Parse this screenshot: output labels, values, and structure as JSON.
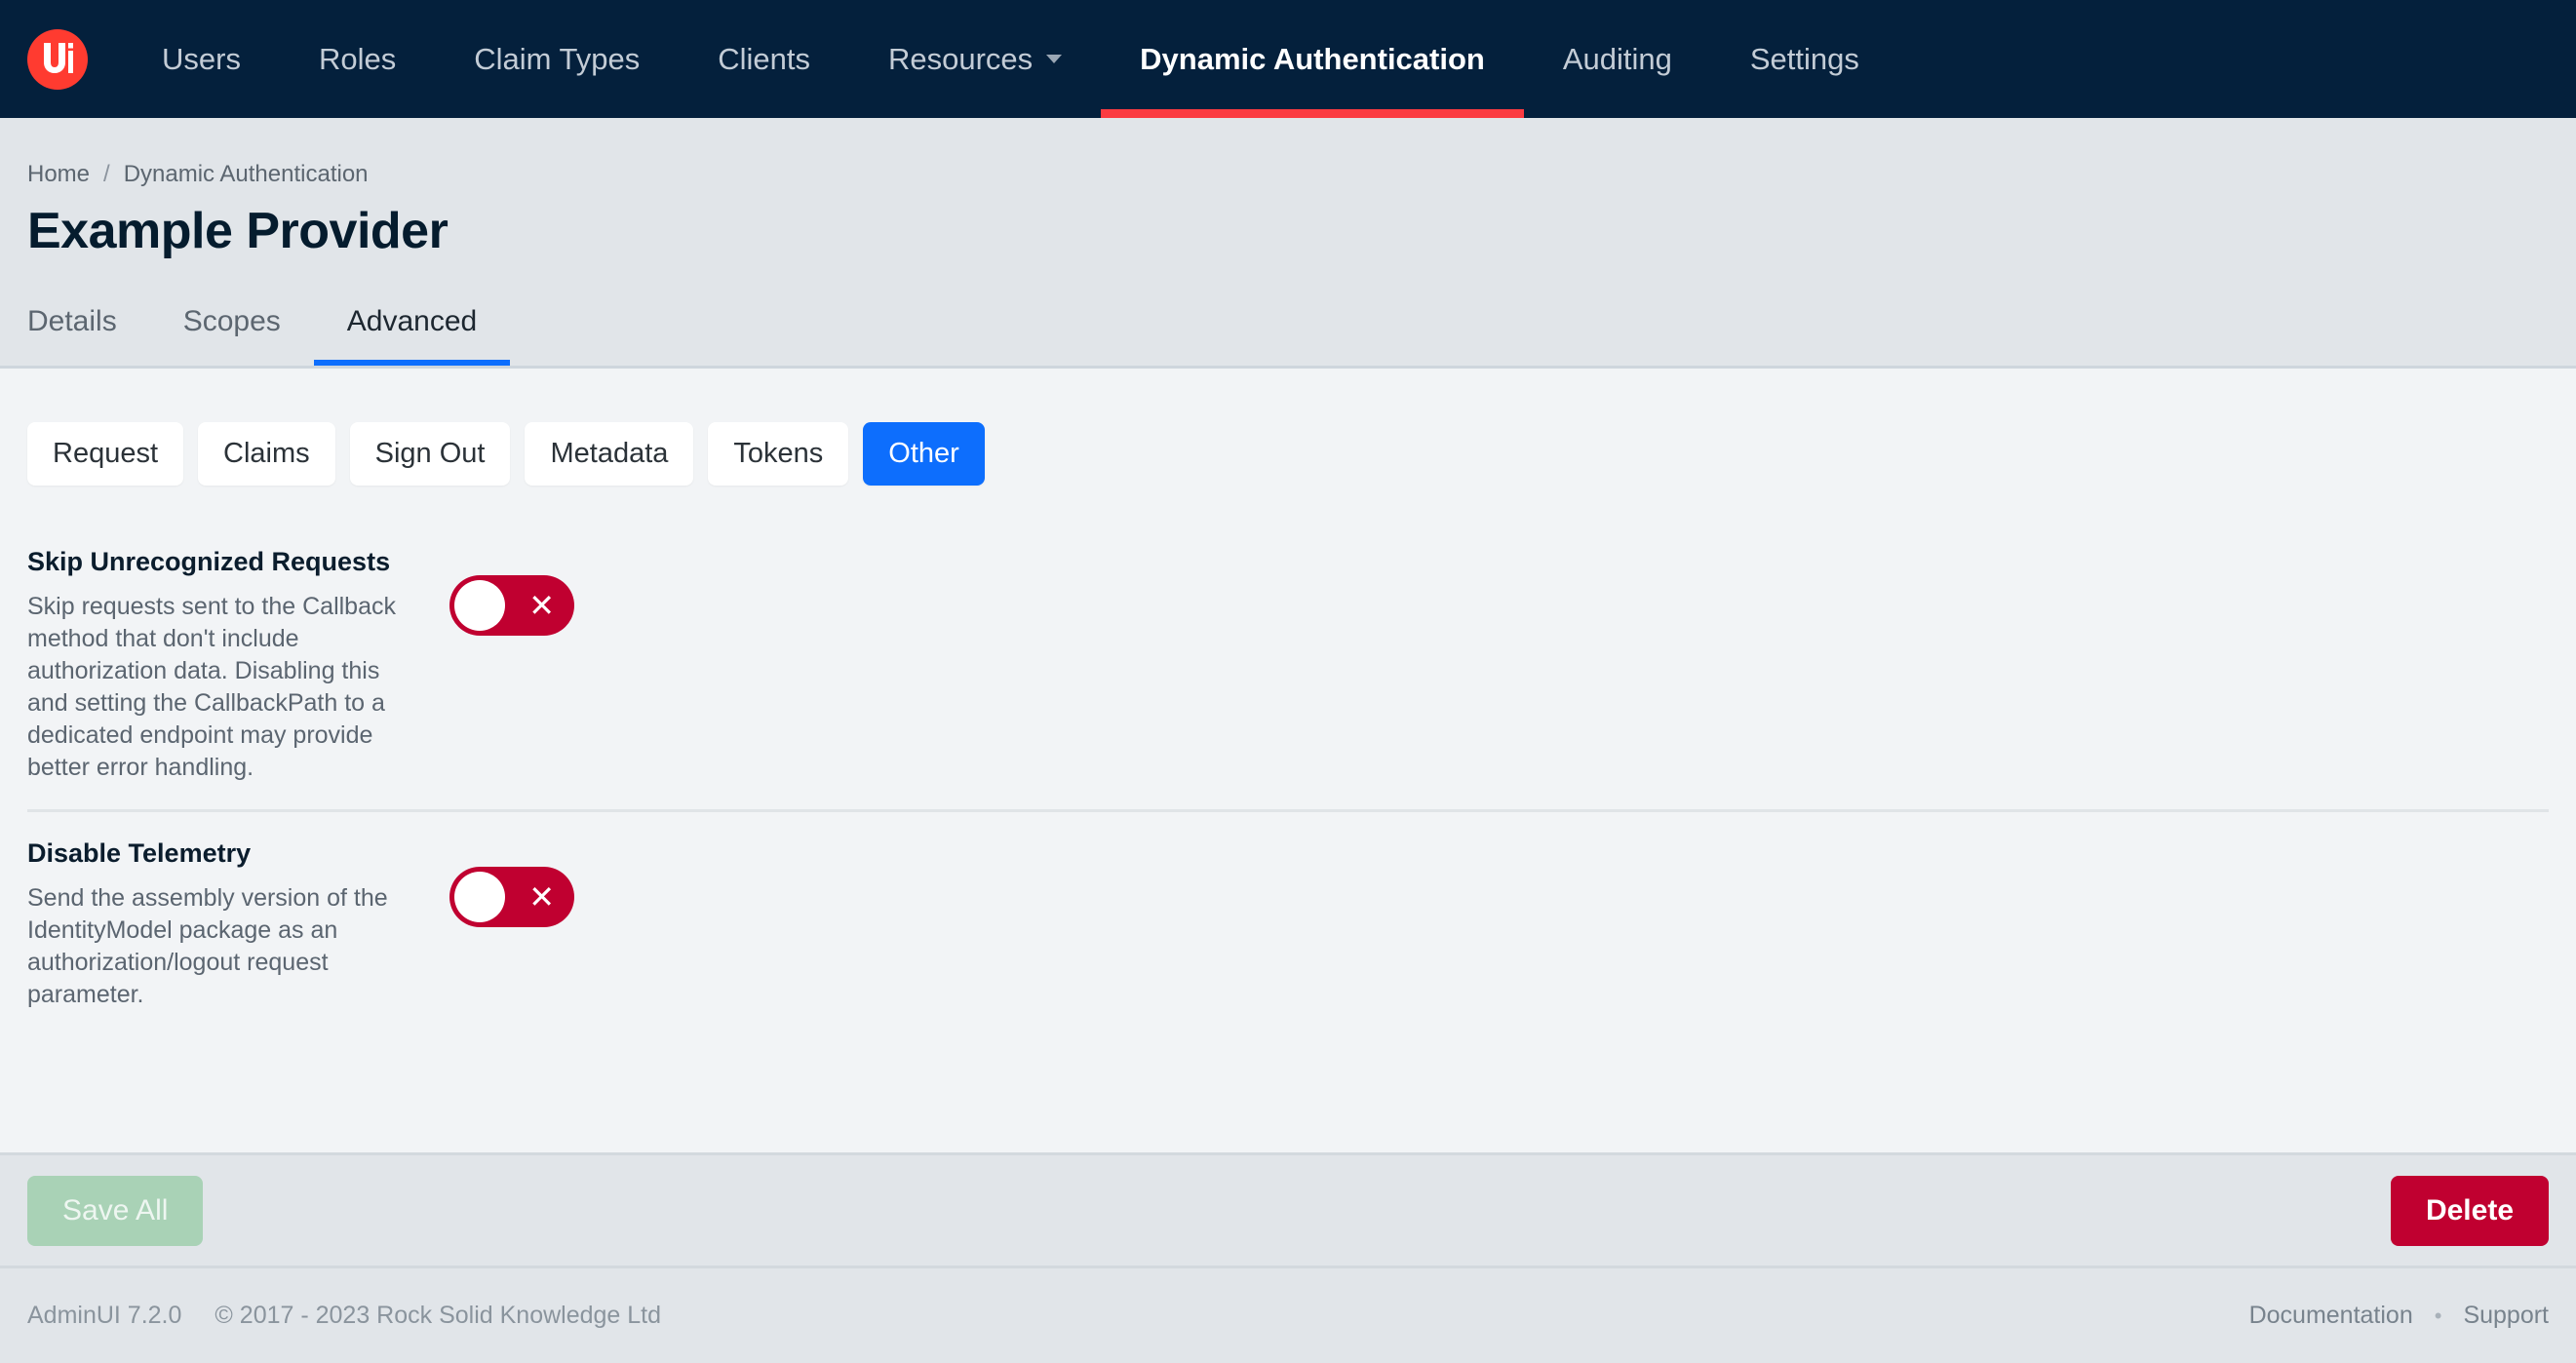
{
  "navbar": {
    "logo_text": "U",
    "logo_icon": "adminui-logo-icon",
    "brand_color": "#ff3b30",
    "background_color": "#04203c",
    "active_indicator_color": "#fb3b41",
    "items": [
      {
        "label": "Users",
        "active": false,
        "has_caret": false
      },
      {
        "label": "Roles",
        "active": false,
        "has_caret": false
      },
      {
        "label": "Claim Types",
        "active": false,
        "has_caret": false
      },
      {
        "label": "Clients",
        "active": false,
        "has_caret": false
      },
      {
        "label": "Resources",
        "active": false,
        "has_caret": true
      },
      {
        "label": "Dynamic Authentication",
        "active": true,
        "has_caret": false
      },
      {
        "label": "Auditing",
        "active": false,
        "has_caret": false
      },
      {
        "label": "Settings",
        "active": false,
        "has_caret": false
      }
    ]
  },
  "header": {
    "breadcrumb": {
      "home": "Home",
      "separator": "/",
      "current": "Dynamic Authentication"
    },
    "title": "Example Provider",
    "tabs": [
      {
        "label": "Details",
        "active": false
      },
      {
        "label": "Scopes",
        "active": false
      },
      {
        "label": "Advanced",
        "active": true
      }
    ],
    "active_tab_color": "#0d6efd"
  },
  "content": {
    "segments": [
      {
        "label": "Request",
        "active": false
      },
      {
        "label": "Claims",
        "active": false
      },
      {
        "label": "Sign Out",
        "active": false
      },
      {
        "label": "Metadata",
        "active": false
      },
      {
        "label": "Tokens",
        "active": false
      },
      {
        "label": "Other",
        "active": true
      }
    ],
    "segment_active_color": "#0d6efd",
    "toggle_off_color": "#c00030",
    "settings": [
      {
        "title": "Skip Unrecognized Requests",
        "description": "Skip requests sent to the Callback method that don't include authorization data. Disabling this and setting the CallbackPath to a dedicated endpoint may provide better error handling.",
        "toggle_state": "off",
        "toggle_mark": "✕"
      },
      {
        "title": "Disable Telemetry",
        "description": "Send the assembly version of the IdentityModel package as an authorization/logout request parameter.",
        "toggle_state": "off",
        "toggle_mark": "✕"
      }
    ]
  },
  "actions": {
    "save_label": "Save All",
    "save_disabled": true,
    "save_color": "#a9d2b6",
    "delete_label": "Delete",
    "delete_color": "#c00030"
  },
  "footer": {
    "version": "AdminUI 7.2.0",
    "copyright": "© 2017 - 2023 Rock Solid Knowledge Ltd",
    "documentation": "Documentation",
    "separator": "•",
    "support": "Support"
  }
}
